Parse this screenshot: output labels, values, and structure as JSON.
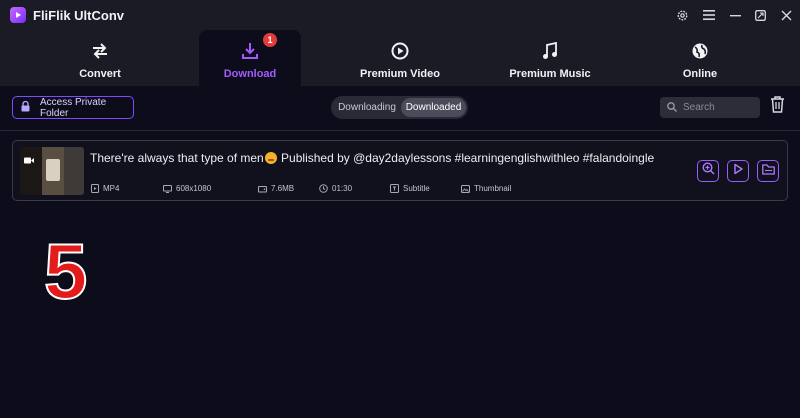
{
  "app": {
    "title": "FliFlik UltConv"
  },
  "window_controls": [
    "gear-icon",
    "menu-icon",
    "minimize-icon",
    "restore-icon",
    "close-icon"
  ],
  "nav": {
    "items": [
      {
        "label": "Convert",
        "icon": "convert-icon"
      },
      {
        "label": "Download",
        "icon": "download-icon",
        "badge": "1",
        "active": true
      },
      {
        "label": "Premium Video",
        "icon": "play-circle-icon"
      },
      {
        "label": "Premium Music",
        "icon": "music-note-icon"
      },
      {
        "label": "Online",
        "icon": "globe-icon"
      }
    ]
  },
  "toolbar": {
    "private_folder_label": "Access Private Folder",
    "segments": [
      "Downloading",
      "Downloaded"
    ],
    "active_segment": "Downloaded",
    "search_placeholder": "Search"
  },
  "items": [
    {
      "title_before": "There're always that type of men",
      "title_after": " Published by @day2daylessons #learningenglishwithleo #falandoingle",
      "format": "MP4",
      "resolution": "608x1080",
      "size": "7.6MB",
      "duration": "01:30",
      "subtitle": "Subtitle",
      "thumbnail": "Thumbnail"
    }
  ],
  "overlay_number": "5",
  "colors": {
    "accent": "#9a5bff",
    "badge": "#e33b3b",
    "background": "#0d0c1a",
    "overlay_number": "#e31b1b"
  }
}
